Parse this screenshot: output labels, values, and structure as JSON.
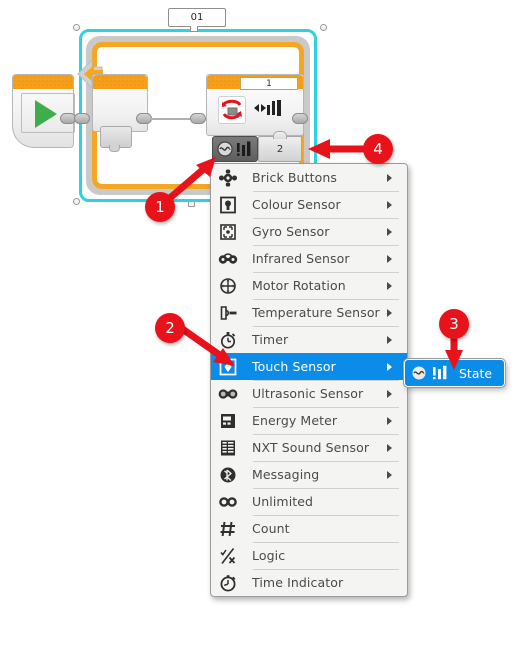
{
  "app": {
    "environment": "LEGO MINDSTORMS EV3 programming canvas with sensor context menu"
  },
  "canvas": {
    "loop_block": {
      "name_label": "01",
      "count_value": "1"
    },
    "start_block": {
      "icon": "play-icon"
    },
    "sensor_tab": {
      "icon": "touch-sensor-icon",
      "secondary_icon": "bars-icon"
    },
    "mode_tab": {
      "label": "2"
    },
    "block_icons": {
      "rotate_icon": "motor-rotate-icon",
      "power_icon": "power-level-icon"
    }
  },
  "context_menu": {
    "items": [
      {
        "label": "Brick Buttons",
        "icon": "brick-buttons-icon",
        "has_submenu": true,
        "selected": false
      },
      {
        "label": "Colour Sensor",
        "icon": "colour-sensor-icon",
        "has_submenu": true,
        "selected": false
      },
      {
        "label": "Gyro Sensor",
        "icon": "gyro-sensor-icon",
        "has_submenu": true,
        "selected": false
      },
      {
        "label": "Infrared Sensor",
        "icon": "infrared-sensor-icon",
        "has_submenu": true,
        "selected": false
      },
      {
        "label": "Motor Rotation",
        "icon": "motor-rotation-icon",
        "has_submenu": true,
        "selected": false
      },
      {
        "label": "Temperature Sensor",
        "icon": "temperature-sensor-icon",
        "has_submenu": true,
        "selected": false
      },
      {
        "label": "Timer",
        "icon": "timer-icon",
        "has_submenu": true,
        "selected": false
      },
      {
        "label": "Touch Sensor",
        "icon": "touch-sensor-icon",
        "has_submenu": true,
        "selected": true
      },
      {
        "label": "Ultrasonic Sensor",
        "icon": "ultrasonic-sensor-icon",
        "has_submenu": true,
        "selected": false
      },
      {
        "label": "Energy Meter",
        "icon": "energy-meter-icon",
        "has_submenu": true,
        "selected": false
      },
      {
        "label": "NXT Sound Sensor",
        "icon": "nxt-sound-sensor-icon",
        "has_submenu": true,
        "selected": false
      },
      {
        "label": "Messaging",
        "icon": "messaging-icon",
        "has_submenu": true,
        "selected": false
      },
      {
        "label": "Unlimited",
        "icon": "infinity-icon",
        "has_submenu": false,
        "selected": false
      },
      {
        "label": "Count",
        "icon": "hash-icon",
        "has_submenu": false,
        "selected": false
      },
      {
        "label": "Logic",
        "icon": "logic-icon",
        "has_submenu": false,
        "selected": false
      },
      {
        "label": "Time Indicator",
        "icon": "time-indicator-icon",
        "has_submenu": false,
        "selected": false
      }
    ]
  },
  "submenu": {
    "items": [
      {
        "label": "State",
        "icon": "touch-sensor-icon"
      }
    ]
  },
  "callouts": [
    {
      "number": "1",
      "target": "sensor-tab"
    },
    {
      "number": "2",
      "target": "touch-sensor-menu-item"
    },
    {
      "number": "3",
      "target": "state-submenu-item"
    },
    {
      "number": "4",
      "target": "mode-tab"
    }
  ],
  "colors": {
    "selection_cyan": "#2fd0e0",
    "loop_orange": "#f5a623",
    "menu_highlight_blue": "#0c8ce9",
    "callout_red": "#e8131a",
    "play_green": "#3fae4a",
    "block_header_orange": "#f79f1a"
  }
}
